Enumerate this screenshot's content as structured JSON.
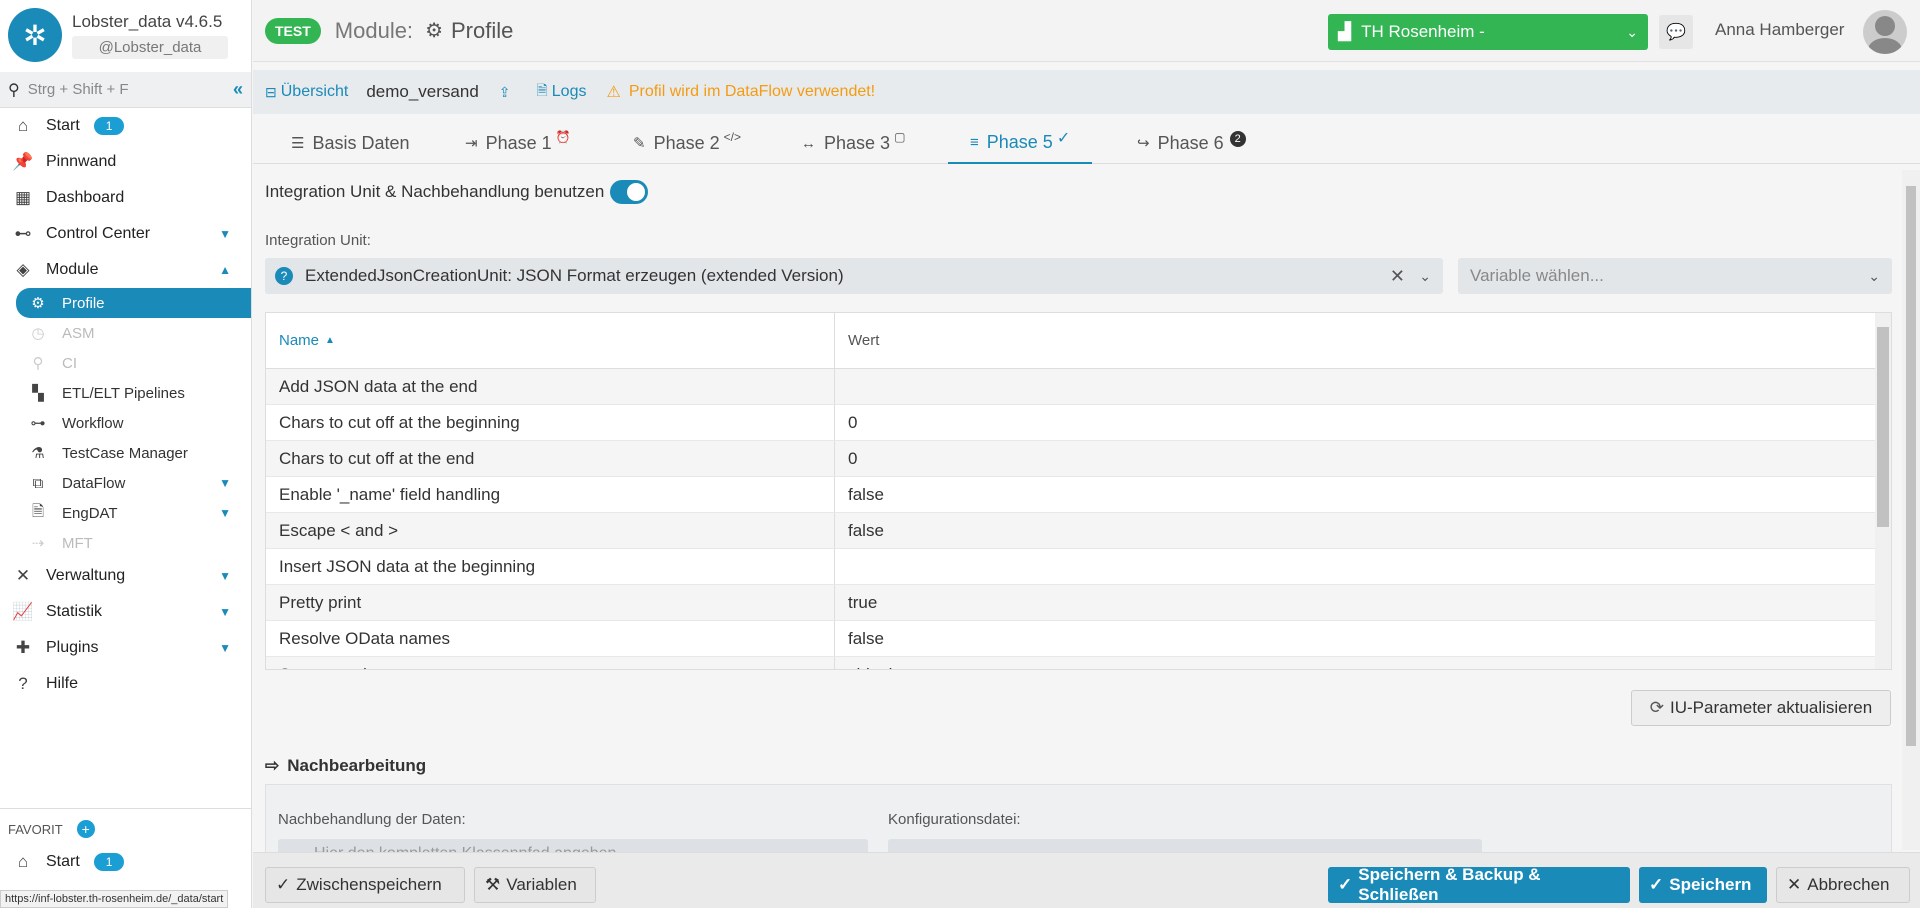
{
  "app": {
    "title": "Lobster_data v4.6.5",
    "handle": "@Lobster_data"
  },
  "sidebar": {
    "search_placeholder": "Strg + Shift + F",
    "items": [
      {
        "label": "Start",
        "badge": "1"
      },
      {
        "label": "Pinnwand"
      },
      {
        "label": "Dashboard"
      },
      {
        "label": "Control Center"
      },
      {
        "label": "Module"
      }
    ],
    "subitems": [
      {
        "label": "Profile"
      },
      {
        "label": "ASM"
      },
      {
        "label": "CI"
      },
      {
        "label": "ETL/ELT Pipelines"
      },
      {
        "label": "Workflow"
      },
      {
        "label": "TestCase Manager"
      },
      {
        "label": "DataFlow"
      },
      {
        "label": "EngDAT"
      },
      {
        "label": "MFT"
      }
    ],
    "items2": [
      {
        "label": "Verwaltung"
      },
      {
        "label": "Statistik"
      },
      {
        "label": "Plugins"
      },
      {
        "label": "Hilfe"
      }
    ],
    "favorit_label": "FAVORIT",
    "fav_start": {
      "label": "Start",
      "badge": "1"
    }
  },
  "status_url": "https://inf-lobster.th-rosenheim.de/_data/start",
  "header": {
    "env": "TEST",
    "module_label": "Module:",
    "module_name": "Profile",
    "org": "TH Rosenheim -",
    "user": "Anna Hamberger"
  },
  "subbar": {
    "overview": "Übersicht",
    "profile_name": "demo_versand",
    "logs": "Logs",
    "warning": "Profil wird im DataFlow verwendet!"
  },
  "tabs": [
    {
      "label": "Basis Daten"
    },
    {
      "label": "Phase 1"
    },
    {
      "label": "Phase 2"
    },
    {
      "label": "Phase 3"
    },
    {
      "label": "Phase 5"
    },
    {
      "label": "Phase 6",
      "count": "2"
    }
  ],
  "content": {
    "toggle_label": "Integration Unit & Nachbehandlung benutzen",
    "iu_label": "Integration Unit:",
    "iu_value": "ExtendedJsonCreationUnit: JSON Format erzeugen (extended Version)",
    "variable_placeholder": "Variable wählen...",
    "grid": {
      "col_name": "Name",
      "col_value": "Wert",
      "rows": [
        {
          "name": "Add JSON data at the end",
          "value": ""
        },
        {
          "name": "Chars to cut off at the beginning",
          "value": "0"
        },
        {
          "name": "Chars to cut off at the end",
          "value": "0"
        },
        {
          "name": "Enable '_name' field handling",
          "value": "false"
        },
        {
          "name": "Escape < and >",
          "value": "false"
        },
        {
          "name": "Insert JSON data at the beginning",
          "value": ""
        },
        {
          "name": "Pretty print",
          "value": "true"
        },
        {
          "name": "Resolve OData names",
          "value": "false"
        },
        {
          "name": "Start at node",
          "value": "shipping"
        }
      ]
    },
    "refresh_button": "IU-Parameter aktualisieren",
    "nach_title": "Nachbearbeitung",
    "nach_label": "Nachbehandlung der Daten:",
    "nach_placeholder": "Hier den kompletten Klassenpfad angeben",
    "config_label": "Konfigurationsdatei:"
  },
  "footer": {
    "zwischen": "Zwischenspeichern",
    "variablen": "Variablen",
    "save_backup_close": "Speichern & Backup & Schließen",
    "save": "Speichern",
    "cancel": "Abbrechen"
  },
  "colors": {
    "accent": "#1a8ab8",
    "green": "#33b553",
    "warning": "#f39c12"
  }
}
